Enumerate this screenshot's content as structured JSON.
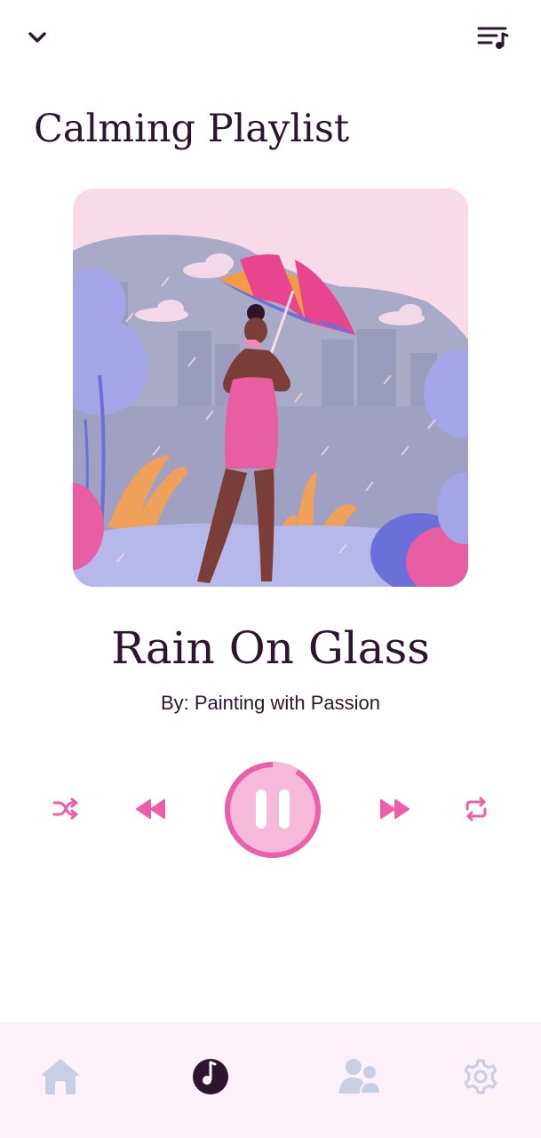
{
  "header": {
    "collapse_icon": "chevron-down-icon",
    "queue_icon": "playlist-music-icon"
  },
  "playlist": {
    "title": "Calming Playlist"
  },
  "track": {
    "title": "Rain On Glass",
    "artist": "By: Painting with Passion",
    "album_art_icon": "woman-with-umbrella-in-rain-illustration"
  },
  "playback": {
    "state": "playing",
    "progress_fraction": 0.08,
    "controls": [
      "shuffle-icon",
      "rewind-icon",
      "pause-icon",
      "fast-forward-icon",
      "repeat-icon"
    ]
  },
  "nav": {
    "items": [
      {
        "icon": "home-icon",
        "active": false
      },
      {
        "icon": "music-player-icon",
        "active": true
      },
      {
        "icon": "friends-icon",
        "active": false
      },
      {
        "icon": "gear-icon",
        "active": false
      }
    ]
  },
  "colors": {
    "accent": "#ec5fa8",
    "accent_light": "#f5b9da",
    "text_dark": "#2d1530",
    "nav_inactive": "#c9cfe3",
    "nav_bg": "#fcf1f8"
  }
}
